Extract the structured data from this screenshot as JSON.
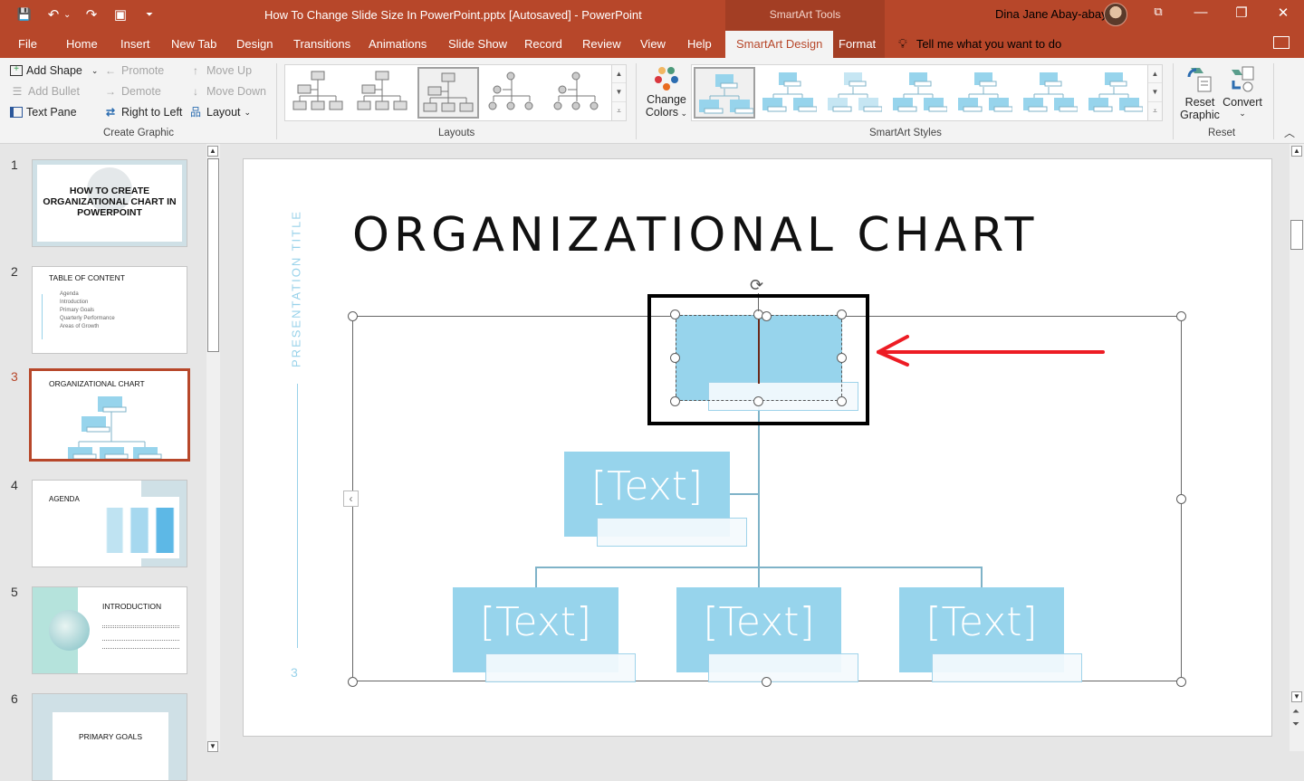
{
  "window": {
    "doc_title": "How To Change Slide Size In PowerPoint.pptx [Autosaved]  -  PowerPoint",
    "contextual_label": "SmartArt Tools",
    "user_name": "Dina Jane Abay-abay",
    "controls": {
      "restore_ribbon": "⧉",
      "minimize": "—",
      "maximize": "❐",
      "close": "✕"
    }
  },
  "qat": {
    "save": "💾",
    "undo": "↶",
    "undo_more": "⌄",
    "redo": "↷",
    "present": "▣",
    "customize": "⏷"
  },
  "tabs": [
    {
      "label": "File"
    },
    {
      "label": "Home"
    },
    {
      "label": "Insert"
    },
    {
      "label": "New Tab"
    },
    {
      "label": "Design"
    },
    {
      "label": "Transitions"
    },
    {
      "label": "Animations"
    },
    {
      "label": "Slide Show"
    },
    {
      "label": "Record"
    },
    {
      "label": "Review"
    },
    {
      "label": "View"
    },
    {
      "label": "Help"
    },
    {
      "label": "SmartArt Design"
    },
    {
      "label": "Format"
    }
  ],
  "tell_me": "Tell me what you want to do",
  "ribbon": {
    "create_graphic": {
      "label": "Create Graphic",
      "add_shape": "Add Shape",
      "add_bullet": "Add Bullet",
      "text_pane": "Text Pane",
      "promote": "Promote",
      "demote": "Demote",
      "right_to_left": "Right to Left",
      "move_up": "Move Up",
      "move_down": "Move Down",
      "layout": "Layout"
    },
    "layouts": {
      "label": "Layouts",
      "selected_index": 2,
      "count": 5
    },
    "change_colors": {
      "line1": "Change",
      "line2": "Colors"
    },
    "smartart_styles": {
      "label": "SmartArt Styles",
      "selected_index": 0,
      "count": 7
    },
    "reset": {
      "label": "Reset",
      "reset_graphic_1": "Reset",
      "reset_graphic_2": "Graphic",
      "convert": "Convert"
    }
  },
  "slides_panel": {
    "active": 3,
    "slides": [
      {
        "num": "1",
        "title": "HOW TO CREATE ORGANIZATIONAL CHART IN POWERPOINT"
      },
      {
        "num": "2",
        "title": "TABLE OF CONTENT",
        "items": [
          "Agenda",
          "Introduction",
          "Primary Goals",
          "Quarterly Performance",
          "Areas of Growth"
        ]
      },
      {
        "num": "3",
        "title": "ORGANIZATIONAL CHART"
      },
      {
        "num": "4",
        "title": "AGENDA"
      },
      {
        "num": "5",
        "title": "INTRODUCTION"
      },
      {
        "num": "6",
        "title": "PRIMARY GOALS"
      }
    ]
  },
  "slide": {
    "side_title": "PRESENTATION TITLE",
    "page_number": "3",
    "title": "ORGANIZATIONAL CHART",
    "org_chart": {
      "top_node": "",
      "assistant_node": "[Text]",
      "children": [
        "[Text]",
        "[Text]",
        "[Text]"
      ]
    },
    "annotation_color": "#ed1c24",
    "node_color": "#97d4ec",
    "accent_color": "#b7472a"
  }
}
